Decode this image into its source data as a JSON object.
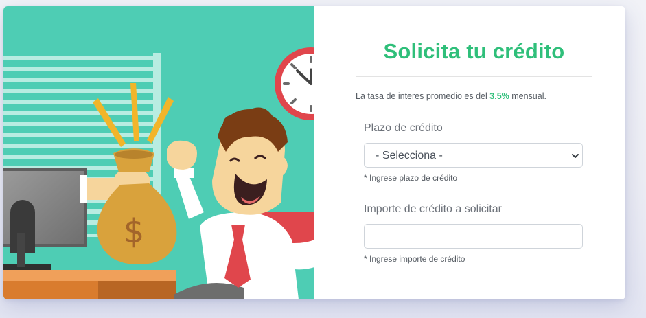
{
  "form": {
    "title": "Solicita tu crédito",
    "rate_prefix": "La tasa de interes promedio es del ",
    "rate_value": "3.5%",
    "rate_suffix": " mensual.",
    "term_label": "Plazo de crédito",
    "term_selected": "- Selecciona -",
    "term_hint": "* Ingrese plazo de crédito",
    "amount_label": "Importe de crédito a solicitar",
    "amount_value": "",
    "amount_hint": "* Ingrese importe de crédito"
  },
  "illustration": {
    "semantic": "happy-businessman-with-money-bag",
    "money_symbol": "$"
  },
  "icons": {
    "select_arrow": "chevron-down-icon",
    "clock": "clock-icon"
  },
  "colors": {
    "accent_green": "#2fbf7a",
    "illustration_bg": "#4ecdb4",
    "tie_red": "#e0464c",
    "money_bag": "#d9a23c"
  }
}
